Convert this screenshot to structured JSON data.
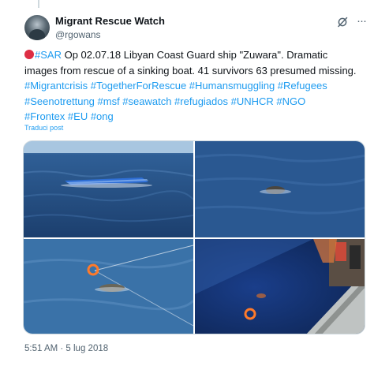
{
  "author": {
    "display_name": "Migrant Rescue Watch",
    "handle": "@rgowans"
  },
  "tweet": {
    "line1_tag": "#SAR",
    "line1_text": " Op 02.07.18 Libyan Coast Guard ship \"Zuwara\". Dramatic",
    "line2_text": "images from rescue of a sinking boat. 41 survivors 63 presumed missing.",
    "line3_tags": "#Migrantcrisis #TogetherForRescue #Humansmuggling #Refugees",
    "line4_tags": "#Seenotrettung #msf #seawatch #refugiados #UNHCR #NGO",
    "line5_tags": "#Frontex #EU #ong"
  },
  "translate_label": "Traduci post",
  "media": [
    {
      "name": "capsized-boat-photo"
    },
    {
      "name": "person-in-water-photo"
    },
    {
      "name": "lifebuoy-rope-photo"
    },
    {
      "name": "ship-side-rescue-photo"
    }
  ],
  "timestamp": "5:51 AM · 5 lug 2018",
  "colors": {
    "link": "#1d9bf0",
    "text": "#0f1419",
    "muted": "#536471",
    "border": "#cfd9de",
    "emoji_red": "#dd2e44"
  },
  "icons": {
    "grok": "grok-icon",
    "more": "more-icon"
  }
}
